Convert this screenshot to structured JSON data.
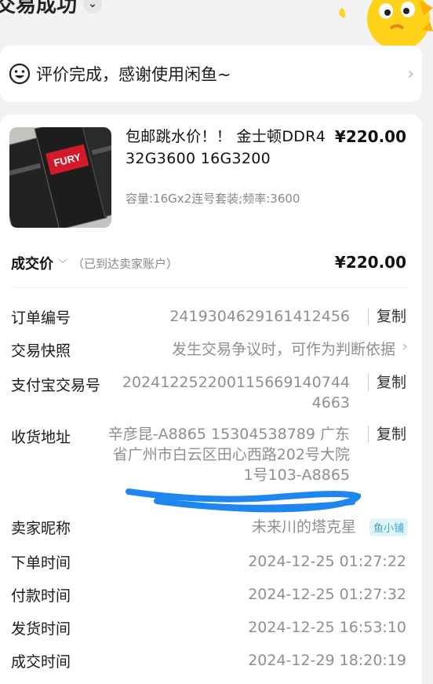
{
  "header": {
    "title": "交易成功"
  },
  "review": {
    "message": "评价完成，感谢使用闲鱼~"
  },
  "product": {
    "title": "包邮跳水价！！ 金士顿DDR4 32G3600 16G3200",
    "price": "¥220.00",
    "spec": "容量:16Gx2连号套装;频率:3600",
    "thumb_text": "FURY"
  },
  "deal": {
    "label": "成交价",
    "note": "（已到达卖家账户）",
    "price": "¥220.00"
  },
  "order": {
    "order_no": {
      "label": "订单编号",
      "value": "2419304629161412456",
      "action": "复制"
    },
    "snapshot": {
      "label": "交易快照",
      "value": "发生交易争议时，可作为判断依据"
    },
    "alipay_no": {
      "label": "支付宝交易号",
      "value_line1": "20241225220011566914074​4",
      "value_line2": "4663",
      "action": "复制"
    },
    "address": {
      "label": "收货地址",
      "line1": "辛彦昆-A8865 15304538789 广东",
      "line2": "省广州市白云区田心西路202号大院",
      "line3": "1号103-A8865",
      "action": "复制"
    },
    "seller": {
      "label": "卖家昵称",
      "value": "未来川的塔克星",
      "badge": "鱼小铺"
    },
    "order_time": {
      "label": "下单时间",
      "value": "2024-12-25 01:27:22"
    },
    "pay_time": {
      "label": "付款时间",
      "value": "2024-12-25 01:27:32"
    },
    "ship_time": {
      "label": "发货时间",
      "value": "2024-12-25 16:53:10"
    },
    "deal_time": {
      "label": "成交时间",
      "value": "2024-12-29 18:20:19"
    }
  },
  "colors": {
    "scribble": "#1f86f0",
    "badge": "#3fa6c9",
    "mascot": "#ffd21a"
  }
}
